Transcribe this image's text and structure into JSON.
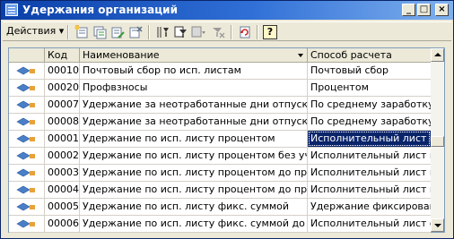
{
  "window": {
    "title": "Удержания организаций"
  },
  "titlebar_buttons": {
    "minimize": "_",
    "maximize": "□",
    "close": "×"
  },
  "toolbar": {
    "actions_label": "Действия",
    "actions_arrow": "▾",
    "icons": [
      "add-icon",
      "copy-icon",
      "edit-icon",
      "delete-icon",
      "filter-icon",
      "filter-set-icon",
      "filter-dropdown-icon",
      "filter-clear-icon",
      "refresh-icon",
      "help-icon"
    ],
    "help_label": "?"
  },
  "table": {
    "columns": [
      "",
      "Код",
      "Наименование",
      "Способ расчета"
    ],
    "sorted_column": "Наименование",
    "selected_row": 4,
    "rows": [
      {
        "code": "00010",
        "name": "Почтовый сбор по исп. листам",
        "method": "Почтовый сбор"
      },
      {
        "code": "00020",
        "name": "Профвзносы",
        "method": "Процентом"
      },
      {
        "code": "00007",
        "name": "Удержание за неотработанные дни отпуска по...",
        "method": "По среднему заработку..."
      },
      {
        "code": "00008",
        "name": "Удержание за неотработанные дни отпуска по...",
        "method": "По среднему заработку..."
      },
      {
        "code": "00001",
        "name": "Удержание по исп. листу процентом",
        "method": "Исполнительный лист п..."
      },
      {
        "code": "00002",
        "name": "Удержание по исп. листу процентом без учета ...",
        "method": "Исполнительный лист п..."
      },
      {
        "code": "00003",
        "name": "Удержание по исп. листу процентом до предела",
        "method": "Исполнительный лист п..."
      },
      {
        "code": "00004",
        "name": "Удержание по исп. листу процентом до предела",
        "method": "Исполнительный лист п..."
      },
      {
        "code": "00005",
        "name": "Удержание по исп. листу фикс. суммой",
        "method": "Удержание фиксирован..."
      },
      {
        "code": "00006",
        "name": "Удержание по исп. листу фикс. суммой до пре...",
        "method": "Исполнительный лист ф..."
      }
    ]
  },
  "colors": {
    "title_gradient_start": "#0a3fa8",
    "title_gradient_end": "#7fb0ee",
    "selection": "#0a246a",
    "row_icon_blue": "#4a7fc8",
    "row_icon_orange": "#e8a23a"
  }
}
